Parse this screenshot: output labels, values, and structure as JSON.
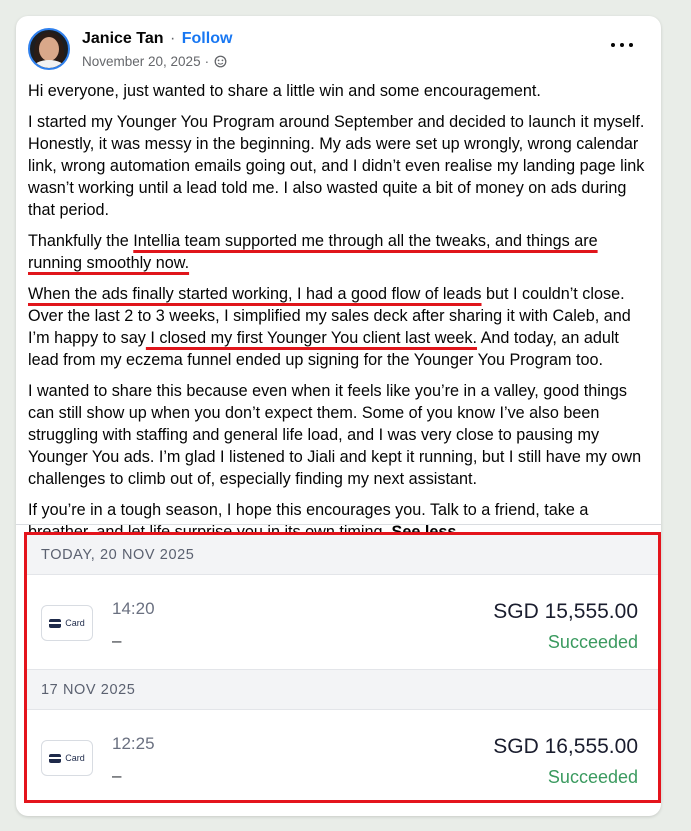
{
  "post": {
    "author": "Janice Tan",
    "separator": "·",
    "follow_label": "Follow",
    "date": "November 20, 2025",
    "meta_separator": "·",
    "privacy_icon": "globe-icon",
    "more_icon": "more-options-icon",
    "p1": "Hi everyone, just wanted to share a little win and some encouragement.",
    "p2": "I started my Younger You Program around September and decided to launch it myself. Honestly, it was messy in the beginning. My ads were set up wrongly, wrong calendar link, wrong automation emails going out, and I didn’t even realise my landing page link wasn’t working until a lead told me. I also wasted quite a bit of money on ads during that period.",
    "p3_a": "Thankfully the ",
    "p3_b": "Intellia team supported me through all the tweaks, and things are running smoothly now.",
    "p4_a": "When the ads finally started working, I had a good flow of leads",
    "p4_b": " but I couldn’t close. Over the last 2 to 3 weeks, I simplified my sales deck after sharing it with Caleb, and I’m happy to say",
    "p4_c": " I closed my first Younger You client last week.",
    "p4_d": " And today, an adult lead from my eczema funnel ended up signing for the Younger You Program too.",
    "p5": "I wanted to share this because even when it feels like you’re in a valley, good things can still show up when you don’t expect them. Some of you know I’ve also been struggling with staffing and general life load, and I was very close to pausing my Younger You ads. I’m glad I listened to Jiali and kept it running, but I still have my own challenges to climb out of, especially finding my next assistant.",
    "p6": "If you’re in a tough season, I hope this encourages you. Talk to a friend, take a breather, and let life surprise you in its own timing.",
    "see_less": "See less"
  },
  "transactions": {
    "highlight_color": "#e4141c",
    "success_color": "#3a9a5f",
    "groups": [
      {
        "date_header": "TODAY, 20 NOV 2025",
        "tx": {
          "method": "Card",
          "method_icon": "credit-card-icon",
          "time": "14:20",
          "description": "–",
          "amount": "SGD 15,555.00",
          "status": "Succeeded"
        }
      },
      {
        "date_header": "17 NOV 2025",
        "tx": {
          "method": "Card",
          "method_icon": "credit-card-icon",
          "time": "12:25",
          "description": "–",
          "amount": "SGD 16,555.00",
          "status": "Succeeded"
        }
      }
    ]
  }
}
